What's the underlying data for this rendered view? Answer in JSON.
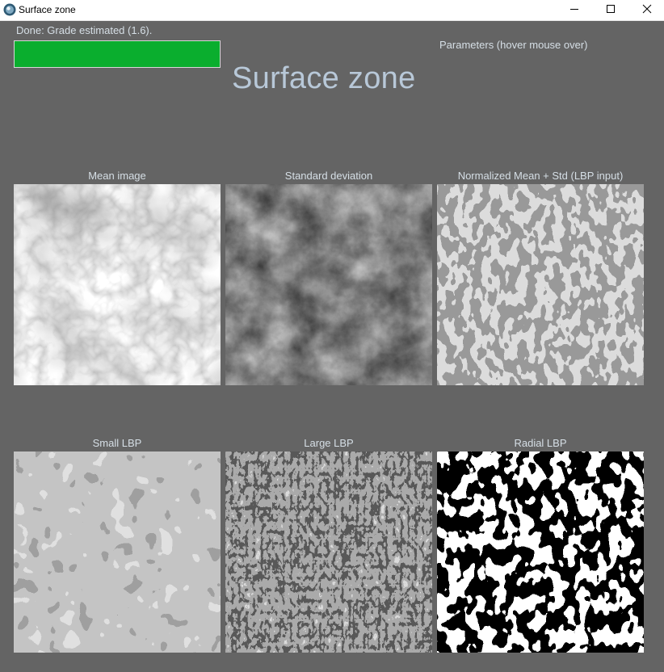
{
  "window": {
    "title": "Surface zone",
    "controls": {
      "minimize": "minimize-icon",
      "maximize": "maximize-icon",
      "close": "close-icon"
    }
  },
  "status": {
    "text": "Done: Grade estimated (1.6).",
    "progress_percent": 100,
    "progress_color": "#0aae2e"
  },
  "parameters_label": "Parameters (hover mouse over)",
  "heading": "Surface zone",
  "panels": [
    {
      "label": "Mean image"
    },
    {
      "label": "Standard deviation"
    },
    {
      "label": "Normalized Mean + Std (LBP input)"
    },
    {
      "label": "Small LBP"
    },
    {
      "label": "Large LBP"
    },
    {
      "label": "Radial LBP"
    }
  ],
  "colors": {
    "background": "#646464",
    "label_text": "#d6dfe6",
    "heading_text": "#b8c8d8"
  }
}
